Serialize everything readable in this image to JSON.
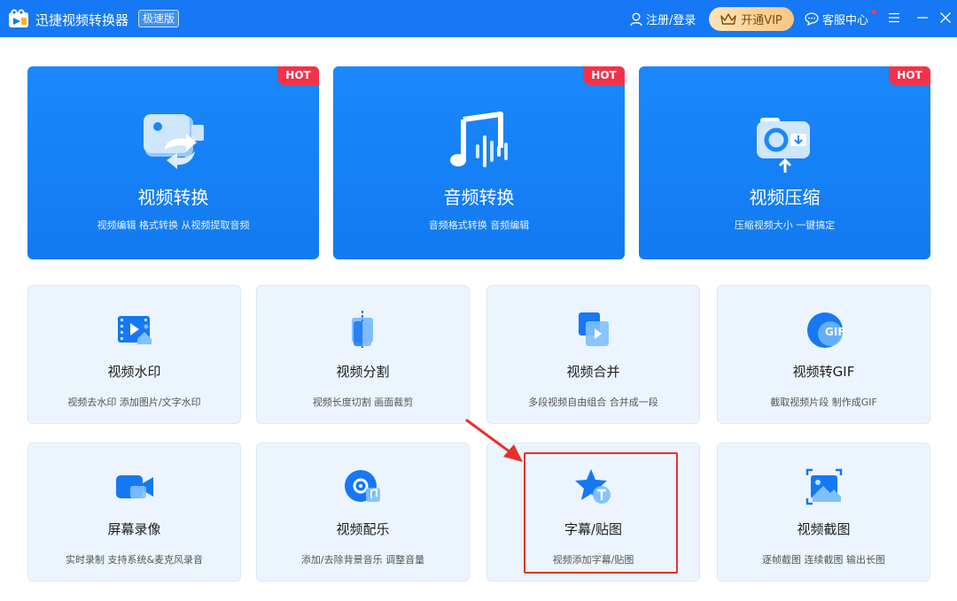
{
  "titlebar": {
    "app_title": "迅捷视频转换器",
    "edition": "极速版",
    "login": "注册/登录",
    "vip": "开通VIP",
    "service": "客服中心"
  },
  "big_cards": [
    {
      "title": "视频转换",
      "desc": "视频编辑 格式转换 从视频提取音频",
      "badge": "HOT"
    },
    {
      "title": "音频转换",
      "desc": "音频格式转换 音频编辑",
      "badge": "HOT"
    },
    {
      "title": "视频压缩",
      "desc": "压缩视频大小 一键搞定",
      "badge": "HOT"
    }
  ],
  "tools": [
    {
      "title": "视频水印",
      "desc": "视频去水印 添加图片/文字水印"
    },
    {
      "title": "视频分割",
      "desc": "视频长度切割 画面裁剪"
    },
    {
      "title": "视频合并",
      "desc": "多段视频自由组合 合并成一段"
    },
    {
      "title": "视频转GIF",
      "desc": "截取视频片段 制作成GIF"
    },
    {
      "title": "屏幕录像",
      "desc": "实时录制 支持系统&麦克风录音"
    },
    {
      "title": "视频配乐",
      "desc": "添加/去除背景音乐 调整音量"
    },
    {
      "title": "字幕/贴图",
      "desc": "视频添加字幕/贴图"
    },
    {
      "title": "视频截图",
      "desc": "逐帧截图 连续截图 输出长图"
    }
  ],
  "colors": {
    "titlebar": "#1678f4",
    "card": "#1a88fb",
    "hot": "#f3324a",
    "highlight": "#e8302a"
  }
}
